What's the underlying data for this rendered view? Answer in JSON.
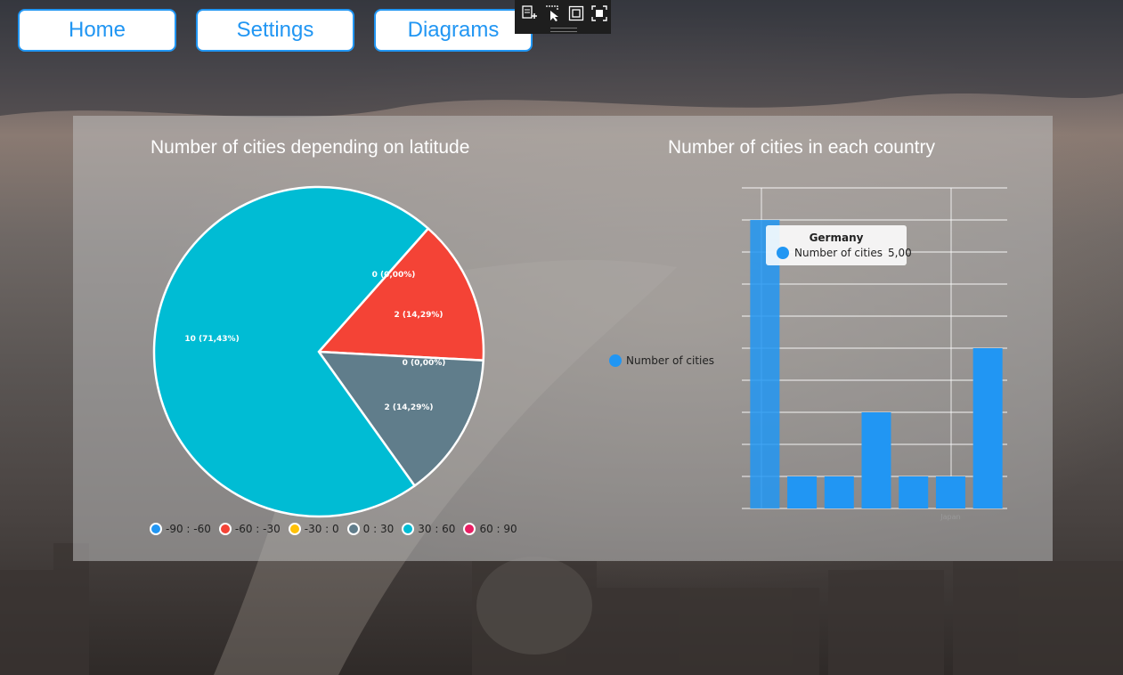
{
  "nav": {
    "home_label": "Home",
    "settings_label": "Settings",
    "diagrams_label": "Diagrams"
  },
  "dev_toolbar": {
    "icons": [
      "live-visual-tree-icon",
      "select-element-icon",
      "display-layout-adorners-icon",
      "track-focus-icon"
    ]
  },
  "charts": {
    "pie_title": "Number of cities depending on latitude",
    "bar_title": "Number of cities in each country",
    "bar_legend_label": "Number of cities",
    "bar_x_label_visible": "Japan",
    "tooltip": {
      "title": "Germany",
      "series": "Number of cities",
      "value": "5,00"
    }
  },
  "colors": {
    "accent": "#2196f3",
    "pie": [
      "#2196f3",
      "#f44336",
      "#ffc107",
      "#607d8b",
      "#00bcd4",
      "#e91e63"
    ]
  },
  "chart_data": [
    {
      "type": "pie",
      "title": "Number of cities depending on latitude",
      "categories": [
        "-90 : -60",
        "-60 : -30",
        "-30 : 0",
        "0 : 30",
        "30 : 60",
        "60 : 90"
      ],
      "values": [
        0,
        2,
        0,
        2,
        10,
        0
      ],
      "data_labels": [
        "",
        "2 (14,29%)",
        "0 (0,00%)",
        "2 (14,29%)",
        "10 (71,43%)",
        "0 (0,00%)"
      ],
      "colors": [
        "#2196f3",
        "#f44336",
        "#ffc107",
        "#607d8b",
        "#00bcd4",
        "#e91e63"
      ],
      "legend": "bottom"
    },
    {
      "type": "bar",
      "title": "Number of cities in each country",
      "series": [
        {
          "name": "Number of cities",
          "values": [
            9,
            1,
            1,
            3,
            1,
            1,
            5
          ]
        }
      ],
      "categories": [
        "Germany",
        "",
        "",
        "",
        "",
        "Japan",
        ""
      ],
      "ylim": [
        0,
        10
      ],
      "grid": true,
      "legend": "left"
    }
  ]
}
